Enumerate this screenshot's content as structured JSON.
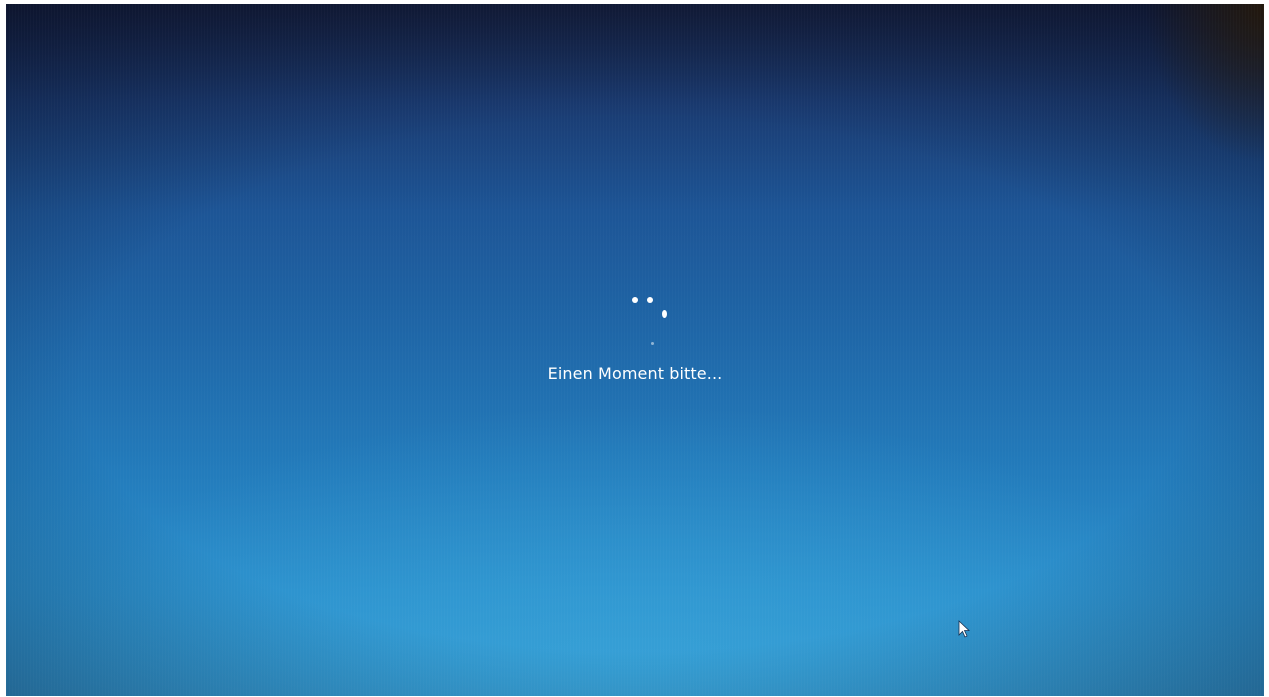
{
  "screen": {
    "status_message": "Einen Moment bitte...",
    "spinner_icon": "loading-spinner-icon",
    "cursor_icon": "mouse-pointer-icon",
    "colors": {
      "background_top": "#141e3c",
      "background_mid": "#1f67a8",
      "background_bottom": "#3399d2",
      "text": "#ffffff"
    }
  }
}
